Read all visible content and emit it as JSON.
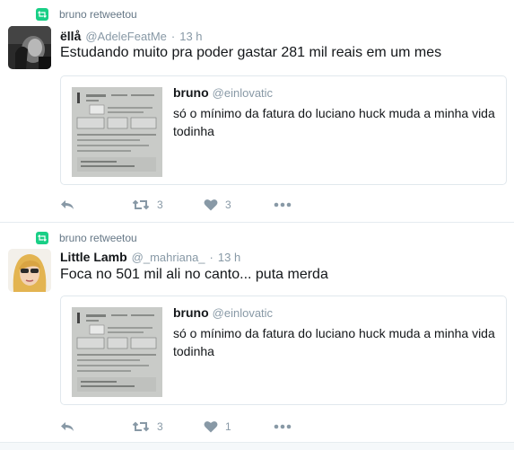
{
  "tweets": [
    {
      "retweeted_by": "bruno retweetou",
      "name": "ëllå",
      "handle": "@AdeleFeatMe",
      "separator": "·",
      "time": "13 h",
      "text": "Estudando muito pra poder gastar 281 mil reais em um mes",
      "quote": {
        "name": "bruno",
        "handle": "@einlovatic",
        "text": "só o mínimo da fatura do luciano huck muda a minha vida todinha"
      },
      "retweet_count": "3",
      "like_count": "3"
    },
    {
      "retweeted_by": "bruno retweetou",
      "name": "Little Lamb",
      "handle": "@_mahriana_",
      "separator": "·",
      "time": "13 h",
      "text": "Foca no 501 mil ali no canto... puta merda",
      "quote": {
        "name": "bruno",
        "handle": "@einlovatic",
        "text": "só o mínimo da fatura do luciano huck muda a minha vida todinha"
      },
      "retweet_count": "3",
      "like_count": "1"
    }
  ],
  "icons": {
    "retweet_badge": "retweet-icon",
    "reply": "reply-icon",
    "retweet": "retweet-icon",
    "like": "heart-icon",
    "more": "more-icon"
  },
  "colors": {
    "retweet_green": "#19cf86",
    "muted": "#8899a6",
    "text": "#14171a",
    "border": "#e1e8ed"
  }
}
